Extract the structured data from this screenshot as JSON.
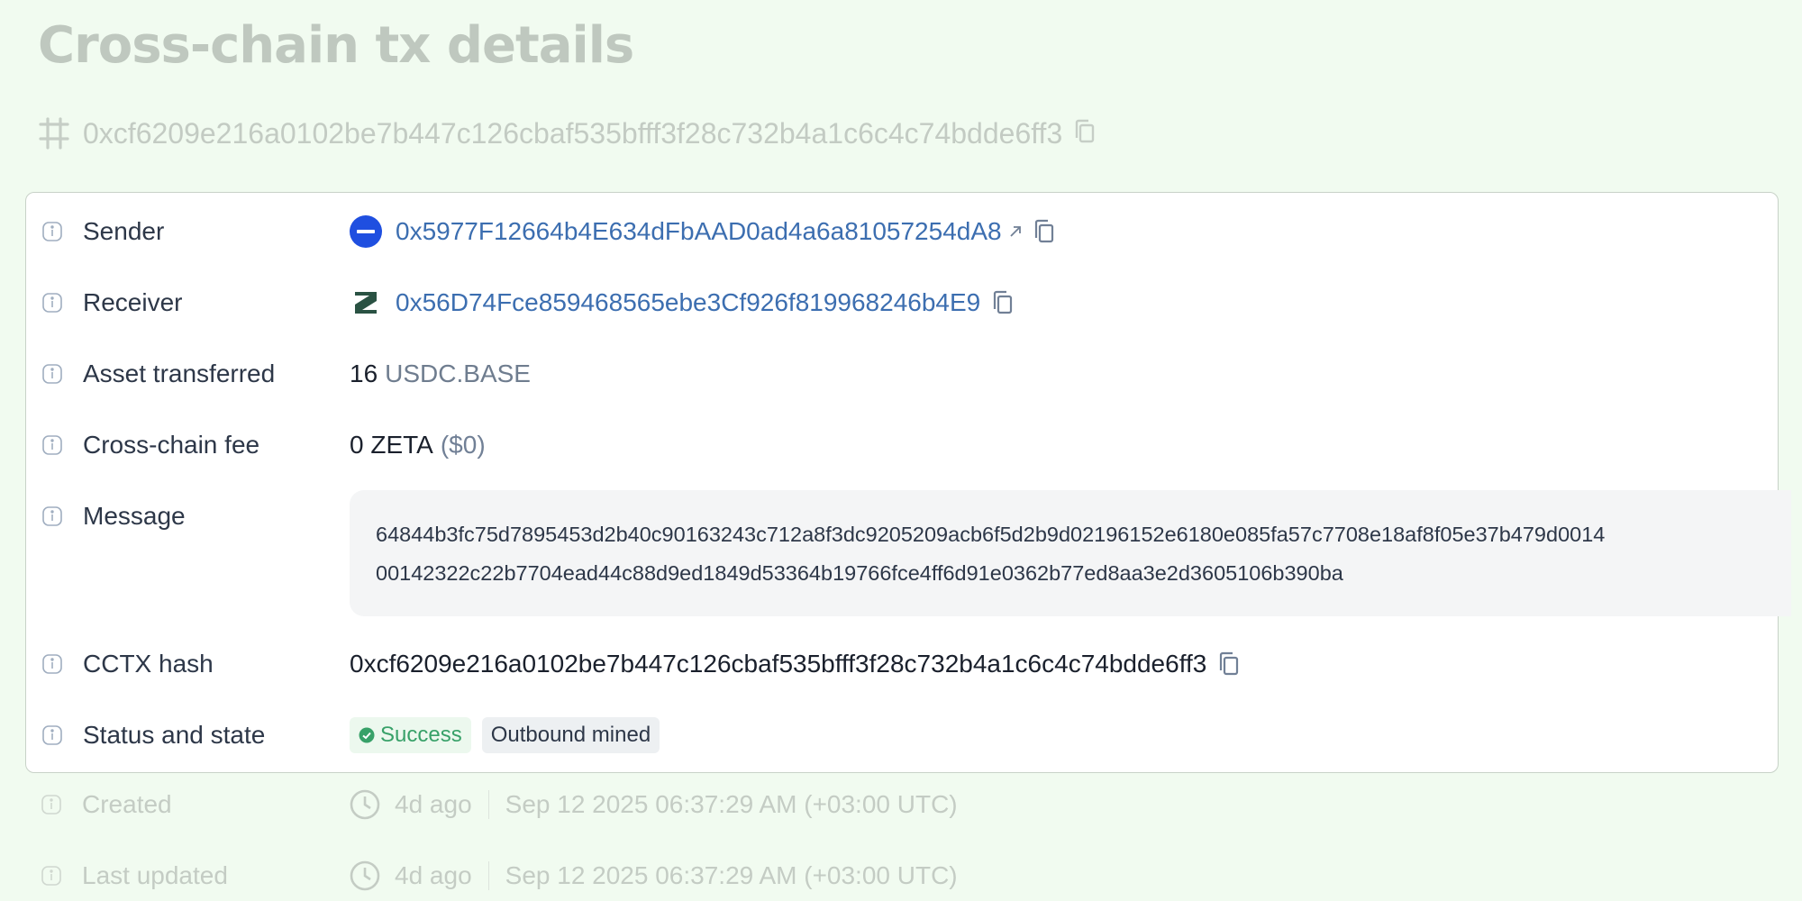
{
  "page": {
    "title": "Cross-chain tx details",
    "tx_hash": "0xcf6209e216a0102be7b447c126cbaf535bfff3f28c732b4a1c6c4c74bdde6ff3"
  },
  "details": {
    "sender": {
      "label": "Sender",
      "address": "0x5977F12664b4E634dFbAAD0ad4a6a81057254dA8"
    },
    "receiver": {
      "label": "Receiver",
      "address": "0x56D74Fce859468565ebe3Cf926f819968246b4E9"
    },
    "asset": {
      "label": "Asset transferred",
      "amount": "16",
      "symbol": "USDC.BASE"
    },
    "fee": {
      "label": "Cross-chain fee",
      "amount": "0 ZETA",
      "usd": "($0)"
    },
    "message": {
      "label": "Message",
      "line1": "64844b3fc75d7895453d2b40c90163243c712a8f3dc9205209acb6f5d2b9d02196152e6180e085fa57c7708e18af8f05e37b479d0014",
      "line2": "00142322c22b7704ead44c88d9ed1849d53364b19766fce4ff6d91e0362b77ed8aa3e2d3605106b390ba"
    },
    "cctx": {
      "label": "CCTX hash",
      "hash": "0xcf6209e216a0102be7b447c126cbaf535bfff3f28c732b4a1c6c4c74bdde6ff3"
    },
    "status": {
      "label": "Status and state",
      "status": "Success",
      "state": "Outbound mined"
    },
    "created": {
      "label": "Created",
      "relative": "4d ago",
      "timestamp": "Sep 12 2025 06:37:29 AM (+03:00 UTC)"
    },
    "updated": {
      "label": "Last updated",
      "relative": "4d ago",
      "timestamp": "Sep 12 2025 06:37:29 AM (+03:00 UTC)"
    }
  },
  "colors": {
    "background": "#f1fbf0",
    "link": "#3c6eb0",
    "success": "#38a169",
    "sender_chain": "#1f4fe0",
    "receiver_chain": "#2a5243"
  },
  "icons": [
    "hash-icon",
    "copy-icon",
    "info-icon",
    "base-chain-icon",
    "zetachain-icon",
    "external-link-icon",
    "check-circle-icon",
    "clock-icon"
  ]
}
